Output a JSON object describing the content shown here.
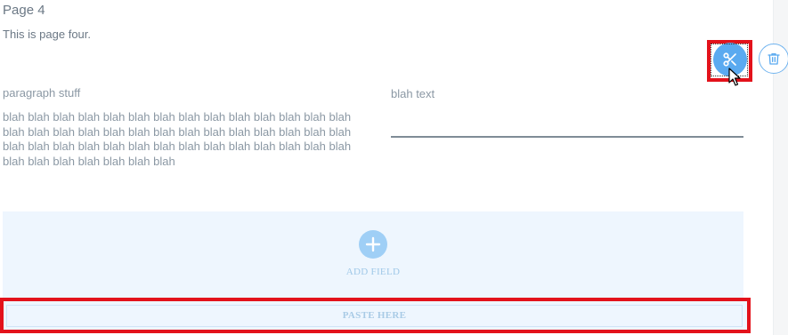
{
  "page": {
    "title": "Page 4",
    "description": "This is page four."
  },
  "fields": {
    "paragraph": {
      "label": "paragraph stuff",
      "text": " blah  blah blah blah blah blah blah blah blah blah blah blah blah blah blah blah blah blah blah blah blah blah blah blah blah blah blah blah blah blah blah blah blah blah blah blah blah blah blah blah blah blah blah blah blah blah blah blah blah"
    },
    "blah": {
      "label": "blah text",
      "value": ""
    }
  },
  "actions": {
    "cut_icon": "scissors-icon",
    "delete_icon": "trash-icon"
  },
  "add_field": {
    "label": "ADD FIELD"
  },
  "paste": {
    "label": "PASTE HERE"
  },
  "colors": {
    "accent": "#5aaaf0",
    "highlight_border": "#e3121b",
    "drop_zone_bg": "#eef6fe"
  }
}
